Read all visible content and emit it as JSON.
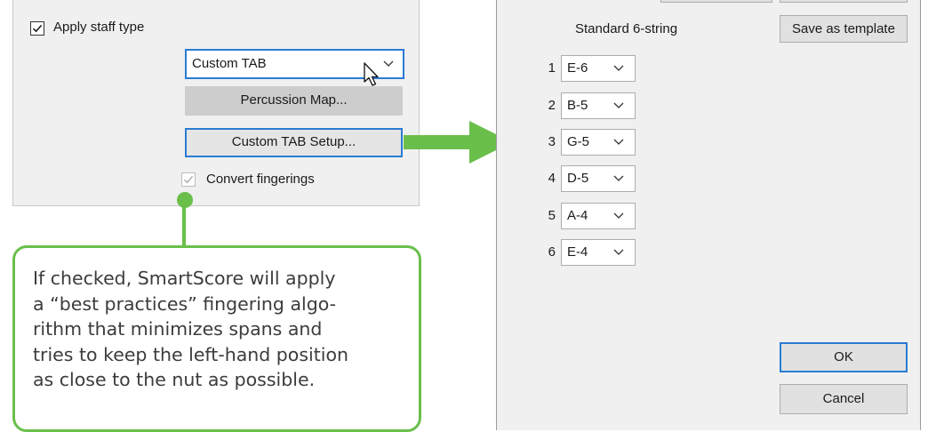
{
  "staff_panel": {
    "apply_staff_type": {
      "label": "Apply staff type",
      "checked": true
    },
    "staff_type_select": {
      "value": "Custom TAB"
    },
    "percussion_map_button": "Percussion Map...",
    "custom_tab_setup_button": "Custom TAB Setup...",
    "convert_fingerings": {
      "label": "Convert fingerings",
      "checked": true,
      "disabled": true
    }
  },
  "callout": {
    "lines": [
      "If checked, SmartScore will apply",
      "a “best practices” fingering algo-",
      "rithm that minimizes spans and",
      "tries to keep the left-hand position",
      "as close to the nut as possible."
    ]
  },
  "tab_setup_dialog": {
    "tuning_name": "Standard 6-string",
    "save_template_button": "Save as template",
    "strings": [
      {
        "number": "1",
        "pitch": "E-6"
      },
      {
        "number": "2",
        "pitch": "B-5"
      },
      {
        "number": "3",
        "pitch": "G-5"
      },
      {
        "number": "4",
        "pitch": "D-5"
      },
      {
        "number": "5",
        "pitch": "A-4"
      },
      {
        "number": "6",
        "pitch": "E-4"
      }
    ],
    "ok_button": "OK",
    "cancel_button": "Cancel"
  },
  "colors": {
    "accent_blue": "#2b7bd3",
    "callout_green": "#6abf4b",
    "panel_gray": "#f0f0f0"
  }
}
